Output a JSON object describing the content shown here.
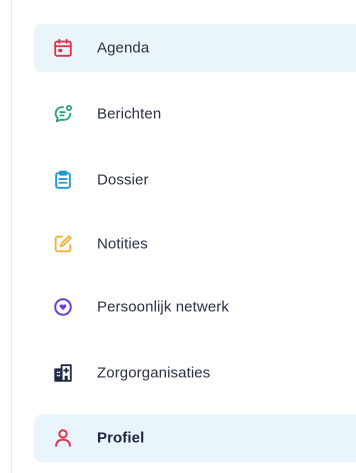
{
  "sidebar": {
    "items": [
      {
        "label": "Agenda",
        "icon": "calendar-icon",
        "color": "#e0314d",
        "active": true
      },
      {
        "label": "Berichten",
        "icon": "chat-bubble-icon",
        "color": "#22a870",
        "active": false
      },
      {
        "label": "Dossier",
        "icon": "clipboard-icon",
        "color": "#1e9bd7",
        "active": false
      },
      {
        "label": "Notities",
        "icon": "pencil-note-icon",
        "color": "#f0b43a",
        "active": false
      },
      {
        "label": "Persoonlijk netwerk",
        "icon": "network-heart-icon",
        "color": "#6b3fd4",
        "active": false
      },
      {
        "label": "Zorgorganisaties",
        "icon": "building-icon",
        "color": "#1f2a44",
        "active": false
      },
      {
        "label": "Profiel",
        "icon": "person-icon",
        "color": "#e0314d",
        "active": true
      }
    ]
  },
  "colors": {
    "active_background": "#e9f5fa",
    "text": "#2a2f45",
    "divider": "#e6e8ec"
  }
}
